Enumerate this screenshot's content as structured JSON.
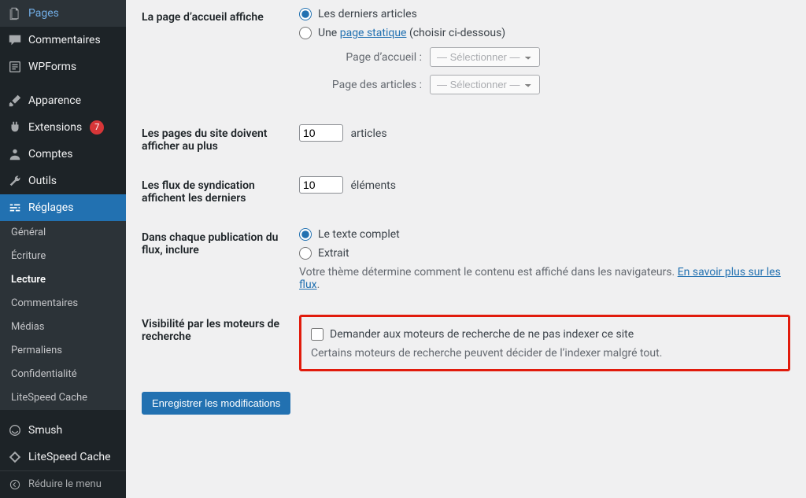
{
  "sidebar": {
    "items": [
      {
        "label": "Pages",
        "icon": "pages"
      },
      {
        "label": "Commentaires",
        "icon": "comment"
      },
      {
        "label": "WPForms",
        "icon": "wpforms"
      },
      {
        "sep": true
      },
      {
        "label": "Apparence",
        "icon": "brush"
      },
      {
        "label": "Extensions",
        "icon": "plugin",
        "badge": "7"
      },
      {
        "label": "Comptes",
        "icon": "user"
      },
      {
        "label": "Outils",
        "icon": "wrench"
      },
      {
        "label": "Réglages",
        "icon": "sliders",
        "current": true
      },
      {
        "sep": true
      },
      {
        "label": "Smush",
        "icon": "smush"
      },
      {
        "label": "LiteSpeed Cache",
        "icon": "litespeed"
      }
    ],
    "submenu": [
      "Général",
      "Écriture",
      "Lecture",
      "Commentaires",
      "Médias",
      "Permaliens",
      "Confidentialité",
      "LiteSpeed Cache"
    ],
    "submenu_current": "Lecture",
    "collapse_label": "Réduire le menu"
  },
  "settings": {
    "homepage_displays": {
      "label": "La page d’accueil affiche",
      "opt_latest": "Les derniers articles",
      "opt_static_prefix": "Une ",
      "opt_static_link": "page statique",
      "opt_static_suffix": " (choisir ci-dessous)",
      "home_label": "Page d’accueil :",
      "posts_label": "Page des articles :",
      "select_placeholder": "— Sélectionner —"
    },
    "posts_per_page": {
      "label": "Les pages du site doivent afficher au plus",
      "value": "10",
      "unit": "articles"
    },
    "feed_items": {
      "label": "Les flux de syndication affichent les derniers",
      "value": "10",
      "unit": "éléments"
    },
    "feed_content": {
      "label": "Dans chaque publication du flux, inclure",
      "opt_full": "Le texte complet",
      "opt_excerpt": "Extrait",
      "desc_prefix": "Votre thème détermine comment le contenu est affiché dans les navigateurs. ",
      "desc_link": "En savoir plus sur les flux",
      "desc_suffix": "."
    },
    "search_visibility": {
      "label": "Visibilité par les moteurs de recherche",
      "checkbox": "Demander aux moteurs de recherche de ne pas indexer ce site",
      "desc": "Certains moteurs de recherche peuvent décider de l’indexer malgré tout."
    },
    "save_button": "Enregistrer les modifications"
  }
}
